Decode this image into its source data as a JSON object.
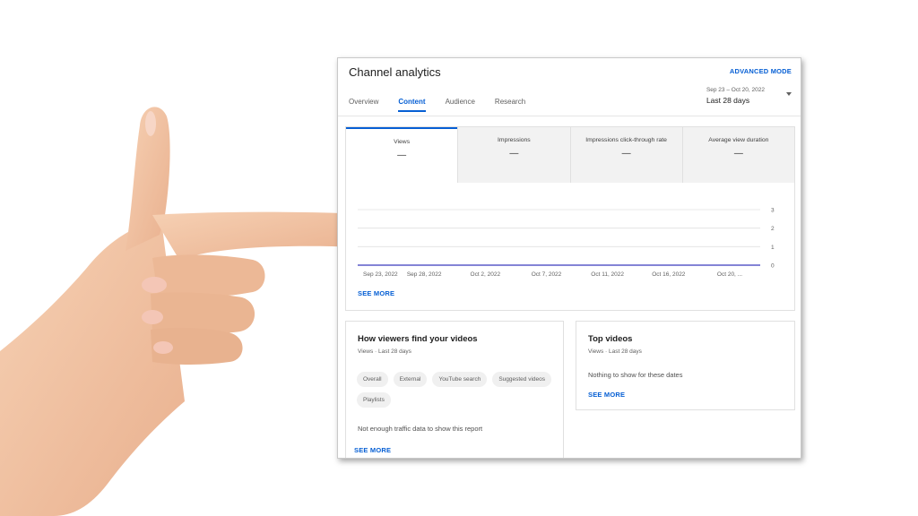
{
  "page": {
    "title": "Channel analytics",
    "advanced_mode": "ADVANCED MODE",
    "tabs": [
      {
        "label": "Overview"
      },
      {
        "label": "Content"
      },
      {
        "label": "Audience"
      },
      {
        "label": "Research"
      }
    ],
    "active_tab": "Content",
    "date_range": {
      "range": "Sep 23 – Oct 20, 2022",
      "label": "Last 28 days"
    }
  },
  "metrics": [
    {
      "label": "Views",
      "value": "—"
    },
    {
      "label": "Impressions",
      "value": "—"
    },
    {
      "label": "Impressions click-through rate",
      "value": "—"
    },
    {
      "label": "Average view duration",
      "value": "—"
    }
  ],
  "chart_data": {
    "type": "line",
    "x": [
      "Sep 23, 2022",
      "Sep 28, 2022",
      "Oct 2, 2022",
      "Oct 7, 2022",
      "Oct 11, 2022",
      "Oct 16, 2022",
      "Oct 20, ..."
    ],
    "series": [
      {
        "values": [
          0,
          0,
          0,
          0,
          0,
          0,
          0
        ]
      }
    ],
    "y_ticks": [
      "0",
      "1",
      "2",
      "3"
    ],
    "ylim": [
      0,
      3
    ],
    "grid": true,
    "line_color": "#5c5cc8"
  },
  "chart_see_more": "SEE MORE",
  "traffic_card": {
    "title": "How viewers find your videos",
    "subtitle": "Views · Last 28 days",
    "chips": [
      "Overall",
      "External",
      "YouTube search",
      "Suggested videos",
      "Playlists"
    ],
    "message": "Not enough traffic data to show this report",
    "see_more": "SEE MORE"
  },
  "top_videos_card": {
    "title": "Top videos",
    "subtitle": "Views · Last 28 days",
    "message": "Nothing to show for these dates",
    "see_more": "SEE MORE"
  },
  "colors": {
    "accent": "#065fd4",
    "skin": "#f2c4a4"
  },
  "illustration": "pointing-hand"
}
